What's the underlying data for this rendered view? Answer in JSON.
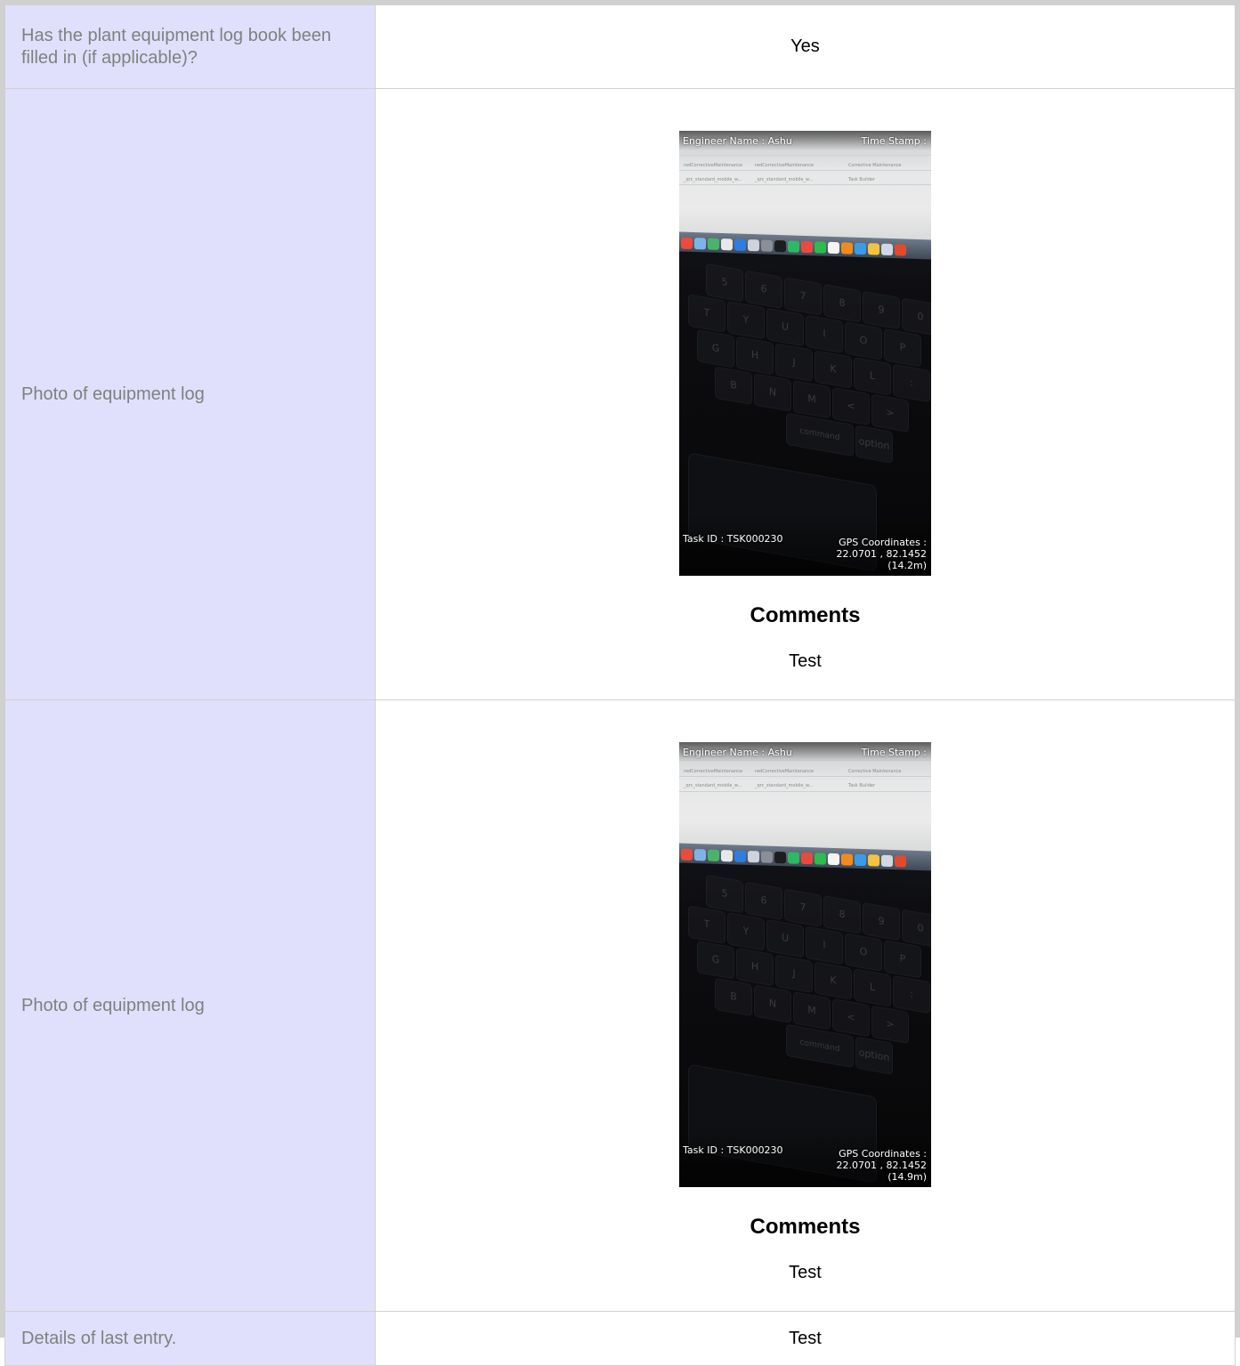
{
  "rows": [
    {
      "label": "Has the plant equipment log book been filled in (if applicable)?",
      "value": "Yes"
    },
    {
      "label": "Photo of equipment log",
      "photo": {
        "engineer": "Engineer Name : Ashu",
        "timestamp": "Time Stamp :",
        "task_id": "Task ID : TSK000230",
        "gps_label": "GPS Coordinates :",
        "gps_coords": "22.0701 , 82.1452",
        "gps_accuracy": "(14.2m)"
      },
      "comments_title": "Comments",
      "comments": "Test"
    },
    {
      "label": "Photo of equipment log",
      "photo": {
        "engineer": "Engineer Name : Ashu",
        "timestamp": "Time Stamp :",
        "task_id": "Task ID : TSK000230",
        "gps_label": "GPS Coordinates :",
        "gps_coords": "22.0701 , 82.1452",
        "gps_accuracy": "(14.9m)"
      },
      "comments_title": "Comments",
      "comments": "Test"
    },
    {
      "label": "Details of last entry.",
      "value": "Test"
    }
  ],
  "colors": {
    "label_background": "#e0e0fc",
    "label_text": "#808080",
    "border": "#d0d0d0"
  }
}
